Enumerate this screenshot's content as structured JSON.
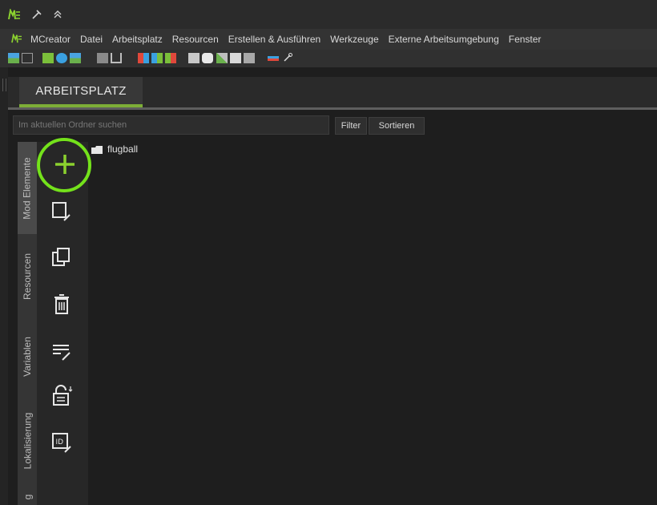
{
  "title_bar": {
    "app_icon": "mcreator-logo-icon",
    "buttons": [
      {
        "name": "pin-icon",
        "glyph": "✱"
      },
      {
        "name": "collapse-icon",
        "glyph": "︽"
      }
    ]
  },
  "menu": {
    "items": [
      "MCreator",
      "Datei",
      "Arbeitsplatz",
      "Resourcen",
      "Erstellen & Ausführen",
      "Werkzeuge",
      "Externe Arbeitsumgebung",
      "Fenster"
    ]
  },
  "workspace": {
    "tab_label": "ARBEITSPLATZ",
    "search_placeholder": "Im aktuellen Ordner suchen",
    "filter_label": "Filter",
    "sort_label": "Sortieren",
    "side_tabs": [
      "Mod Elemente",
      "Resourcen",
      "Variablen",
      "Lokalisierung",
      "g"
    ],
    "tool_icons": [
      "add-icon",
      "edit-icon",
      "duplicate-icon",
      "delete-icon",
      "move-icon",
      "lock-icon",
      "id-edit-icon"
    ],
    "folder_name": "flugball"
  },
  "colors": {
    "accent": "#7dae37",
    "highlight_ring": "#74e21b",
    "plus_green": "#8bd12f"
  }
}
